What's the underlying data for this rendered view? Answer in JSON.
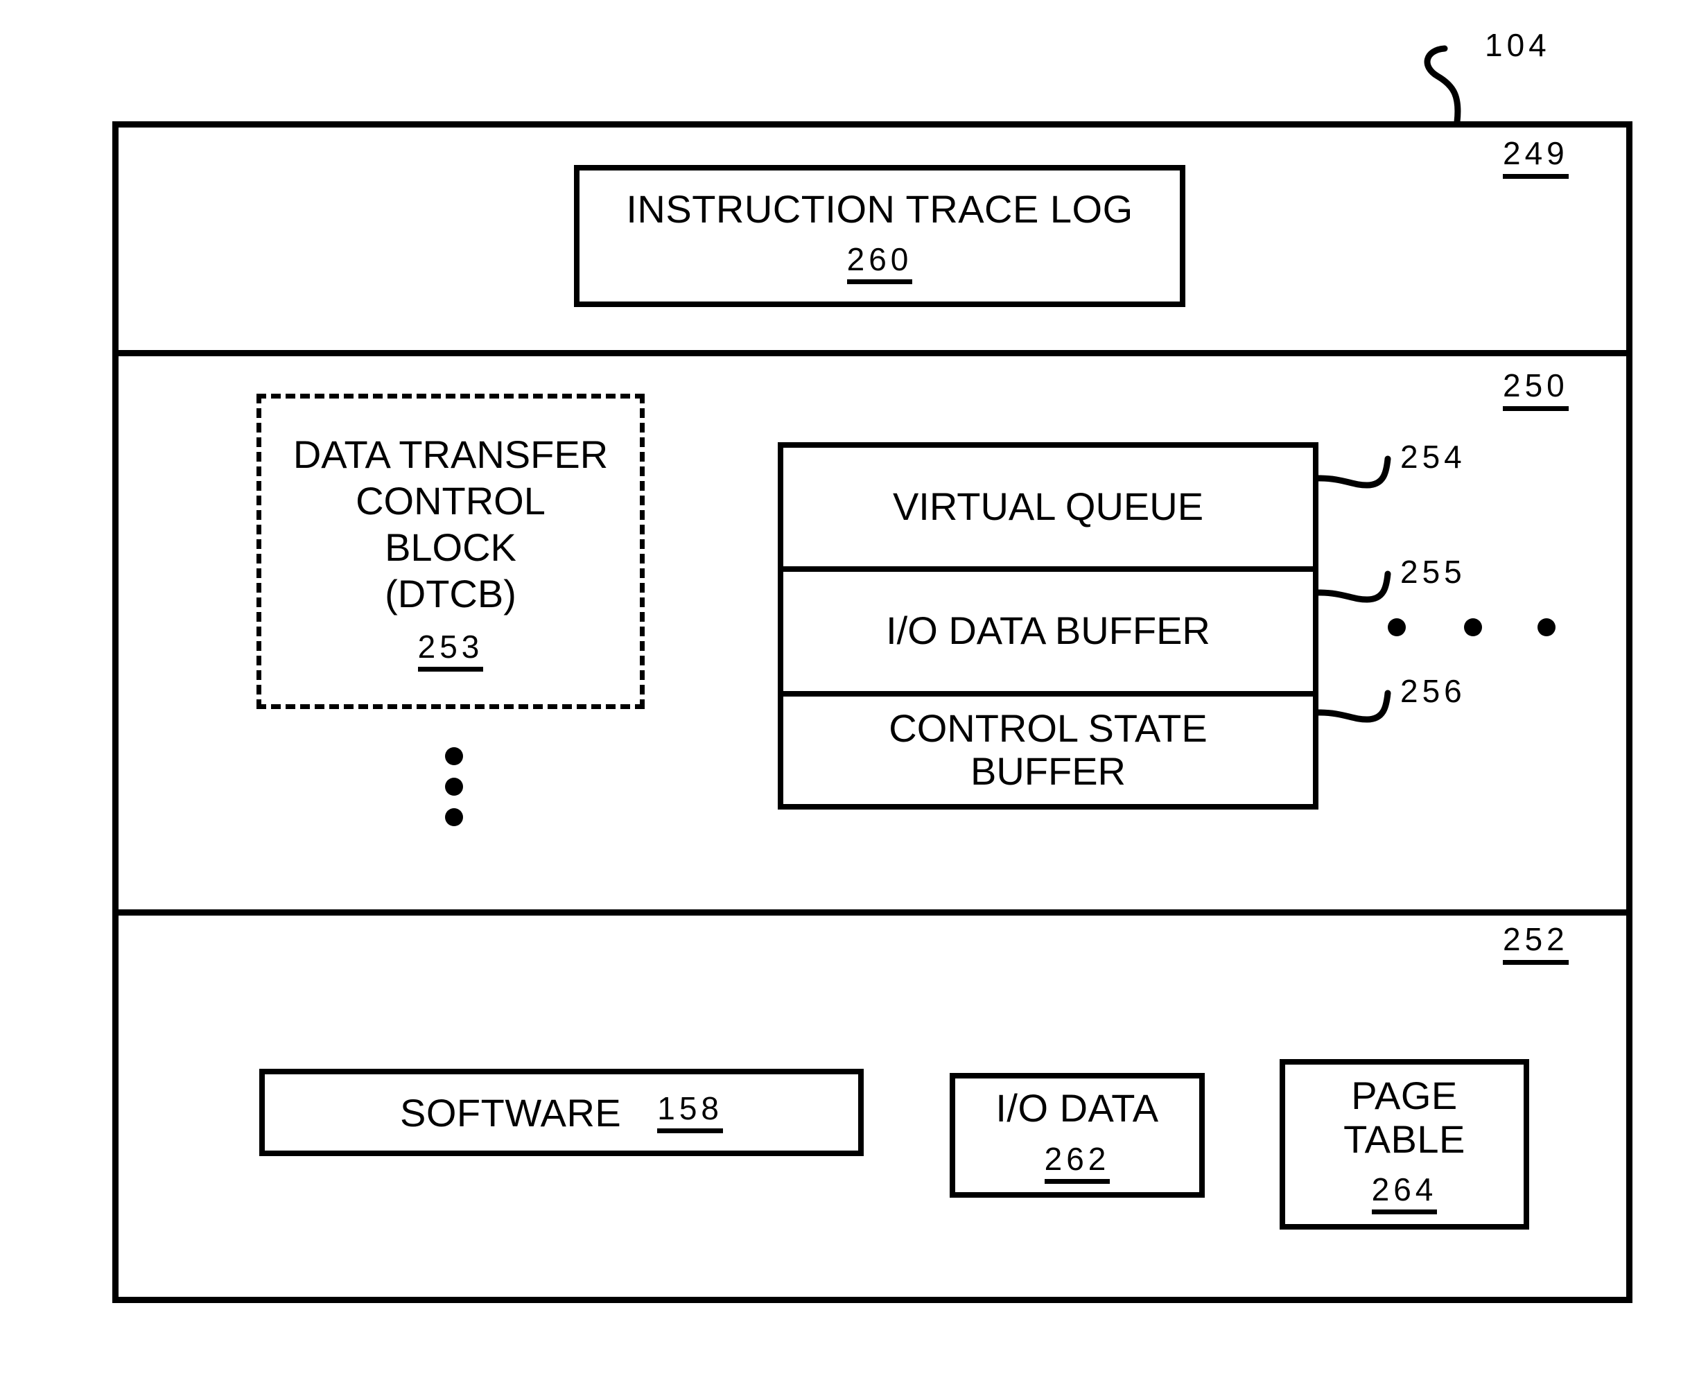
{
  "figure": {
    "root_ref": "104",
    "sections": [
      {
        "ref": "249",
        "box": {
          "title": "INSTRUCTION TRACE LOG",
          "num": "260"
        }
      },
      {
        "ref": "250",
        "dtcb": {
          "title": "DATA TRANSFER\nCONTROL\nBLOCK\n(DTCB)",
          "num": "253"
        },
        "buffers": {
          "items": [
            {
              "label": "VIRTUAL QUEUE",
              "ref": "254"
            },
            {
              "label": "I/O DATA BUFFER",
              "ref": "255"
            },
            {
              "label": "CONTROL STATE\nBUFFER",
              "ref": "256"
            }
          ]
        }
      },
      {
        "ref": "252",
        "boxes": [
          {
            "title": "SOFTWARE",
            "num": "158"
          },
          {
            "title": "I/O DATA",
            "num": "262"
          },
          {
            "title": "PAGE\nTABLE",
            "num": "264"
          }
        ]
      }
    ]
  },
  "colors": {
    "ink": "#000000",
    "paper": "#ffffff"
  }
}
